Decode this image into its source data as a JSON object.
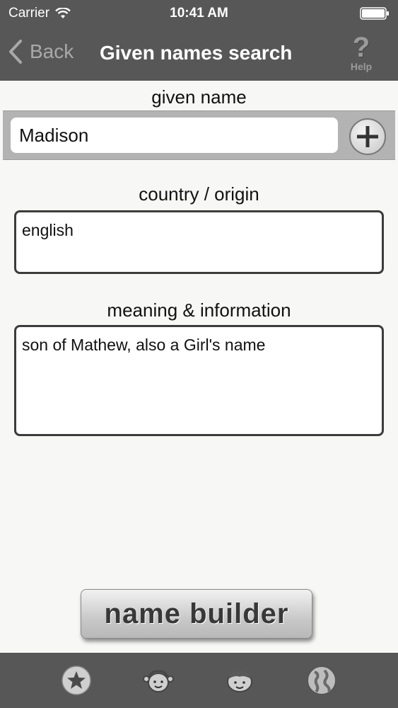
{
  "status_bar": {
    "carrier": "Carrier",
    "time": "10:41 AM"
  },
  "nav": {
    "back_label": "Back",
    "title": "Given names search",
    "help_label": "Help",
    "help_glyph": "?"
  },
  "form": {
    "given_name_label": "given name",
    "given_name_value": "Madison",
    "origin_label": "country / origin",
    "origin_value": "english",
    "meaning_label": "meaning & information",
    "meaning_value": "son of Mathew, also a Girl's name"
  },
  "buttons": {
    "name_builder": "name builder"
  },
  "tabs": [
    {
      "icon": "star-icon"
    },
    {
      "icon": "girl-face-icon"
    },
    {
      "icon": "boy-face-icon"
    },
    {
      "icon": "globe-icon"
    }
  ],
  "colors": {
    "bar": "#575757",
    "background": "#f7f7f5",
    "input_row": "#b3b3b3"
  }
}
